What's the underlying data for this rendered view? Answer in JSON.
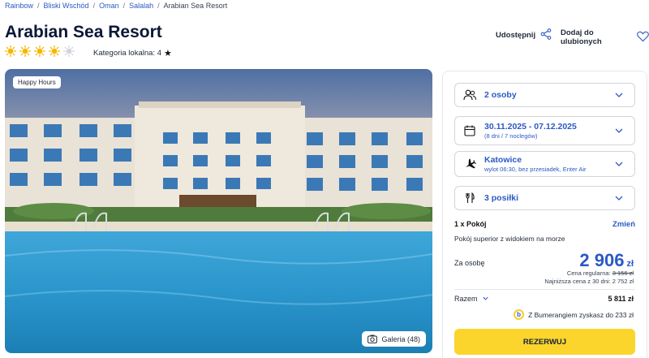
{
  "breadcrumb": {
    "items": [
      "Rainbow",
      "Bliski Wschód",
      "Oman",
      "Salalah"
    ],
    "current": "Arabian Sea Resort",
    "separator": "/"
  },
  "hotel": {
    "name": "Arabian Sea Resort",
    "stars_total": 5,
    "stars_filled": 4,
    "local_category_label": "Kategoria lokalna: 4"
  },
  "actions": {
    "share_label": "Udostępnij",
    "favorite_label": "Dodaj do ulubionych"
  },
  "photo": {
    "badge": "Happy Hours",
    "gallery_label": "Galeria (48)"
  },
  "booking": {
    "guests": "2 osoby",
    "dates": "30.11.2025 - 07.12.2025",
    "dates_sub": "(8 dni / 7 noclegów)",
    "departure_city": "Katowice",
    "departure_sub": "wylot 06:30, bez przesiadek, Enter Air",
    "meals": "3 posiłki",
    "room_count": "1 x Pokój",
    "change_label": "Zmień",
    "room_name": "Pokój superior z widokiem na morze",
    "per_person_label": "Za osobę",
    "price": "2 906",
    "currency": "zł",
    "regular_label": "Cena regularna:",
    "regular_price": "3 156 zł",
    "lowest_30d": "Najniższa cena z 30 dni: 2 752 zł",
    "total_label": "Razem",
    "total": "5 811 zł",
    "bumerang": "Z Bumerangiem zyskasz do 233 zł",
    "reserve_label": "REZERWUJ"
  },
  "colors": {
    "brand_blue": "#2b59c3",
    "accent_yellow": "#fbd52b",
    "sun_active": "#f5b800",
    "sun_inactive": "#d1d5db"
  }
}
